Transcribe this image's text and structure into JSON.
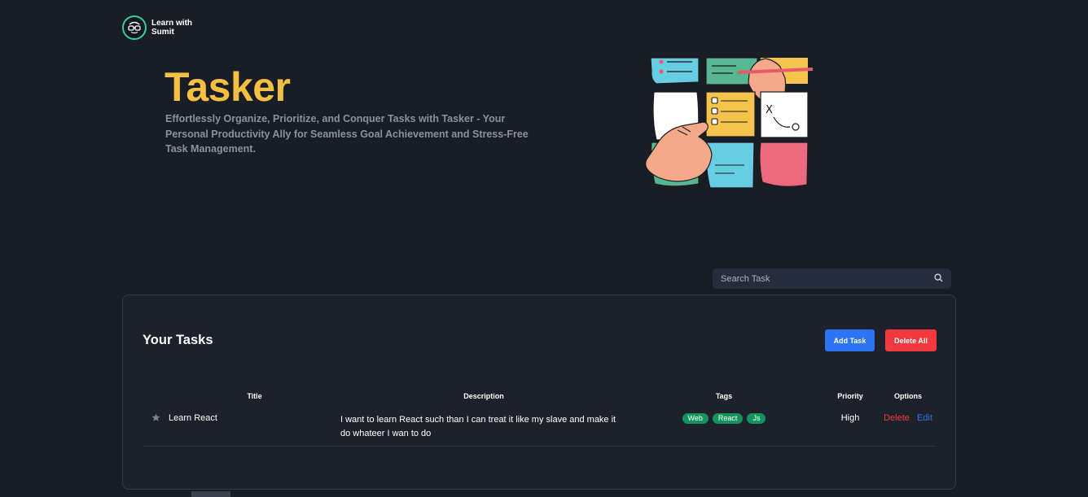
{
  "brand": {
    "logo_text": "Learn with Sumit",
    "logo_icon": "sumit-glasses-logo",
    "accent": "#2fd0a4"
  },
  "hero": {
    "title": "Tasker",
    "title_color": "#f5bf42",
    "description": "Effortlessly Organize, Prioritize, and Conquer Tasks with Tasker - Your Personal Productivity Ally for Seamless Goal Achievement and Stress-Free Task Management.",
    "illustration": "sticky-notes-hands-illustration"
  },
  "search": {
    "placeholder": "Search Task",
    "icon": "search-icon"
  },
  "tasks_panel": {
    "title": "Your Tasks",
    "add_label": "Add Task",
    "delete_all_label": "Delete All",
    "columns": {
      "title": "Title",
      "description": "Description",
      "tags": "Tags",
      "priority": "Priority",
      "options": "Options"
    },
    "rows": [
      {
        "favorite_icon": "star-icon",
        "title": "Learn React",
        "description": "I want to learn React such than I can treat it like my slave and make it do whateer I wan to do",
        "tags": [
          "Web",
          "React",
          "Js"
        ],
        "priority": "High",
        "delete_label": "Delete",
        "edit_label": "Edit"
      }
    ]
  },
  "colors": {
    "background": "#191d26",
    "panel": "#1d212b",
    "add_button": "#2d74f5",
    "delete_button": "#f13a3f",
    "tag": "#15935f",
    "edit_link": "#3178f0"
  }
}
